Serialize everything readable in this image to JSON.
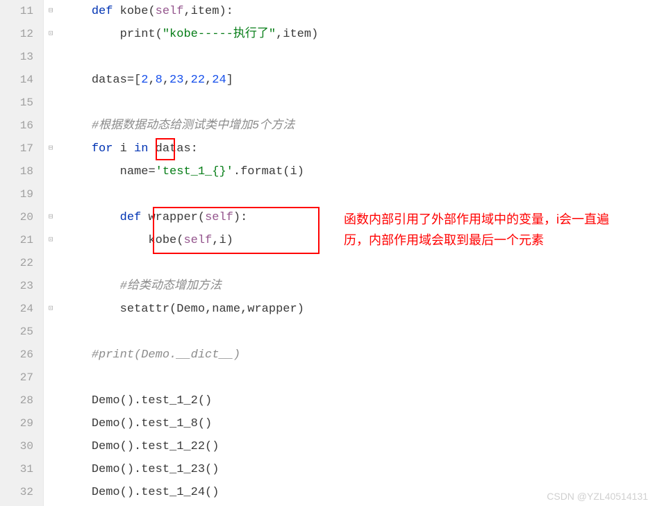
{
  "lines": {
    "11": {
      "n": "11",
      "t": "def",
      "indent": "    "
    },
    "12": {
      "n": "12",
      "indent": "        "
    },
    "13": {
      "n": "13"
    },
    "14": {
      "n": "14",
      "indent": "    "
    },
    "15": {
      "n": "15"
    },
    "16": {
      "n": "16",
      "indent": "    ",
      "comment": "#根据数据动态给测试类中增加5个方法"
    },
    "17": {
      "n": "17",
      "indent": "    "
    },
    "18": {
      "n": "18",
      "indent": "        "
    },
    "19": {
      "n": "19"
    },
    "20": {
      "n": "20",
      "indent": "        "
    },
    "21": {
      "n": "21",
      "indent": "            "
    },
    "22": {
      "n": "22"
    },
    "23": {
      "n": "23",
      "indent": "        ",
      "comment": "#给类动态增加方法"
    },
    "24": {
      "n": "24",
      "indent": "        "
    },
    "25": {
      "n": "25"
    },
    "26": {
      "n": "26",
      "indent": "    ",
      "comment": "#print(Demo.__dict__)"
    },
    "27": {
      "n": "27"
    },
    "28": {
      "n": "28",
      "indent": "    "
    },
    "29": {
      "n": "29",
      "indent": "    "
    },
    "30": {
      "n": "30",
      "indent": "    "
    },
    "31": {
      "n": "31",
      "indent": "    "
    },
    "32": {
      "n": "32",
      "indent": "    "
    }
  },
  "tokens": {
    "def": "def",
    "for": "for",
    "in": "in",
    "kobe": "kobe",
    "wrapper": "wrapper",
    "print": "print",
    "self": "self",
    "item": "item",
    "datas": "datas",
    "i": "i",
    "name": "name",
    "format": "format",
    "setattr": "setattr",
    "Demo": "Demo",
    "str_kobe": "\"kobe-----执行了\"",
    "str_test": "'test_1_{}'",
    "nums": {
      "a": "2",
      "b": "8",
      "c": "23",
      "d": "22",
      "e": "24"
    },
    "calls": {
      "a": "Demo().test_1_2()",
      "b": "Demo().test_1_8()",
      "c": "Demo().test_1_22()",
      "d": "Demo().test_1_23()",
      "e": "Demo().test_1_24()"
    }
  },
  "annotation": {
    "l1": "函数内部引用了外部作用域中的变量，i会一直遍",
    "l2": "历，内部作用域会取到最后一个元素"
  },
  "watermark": "CSDN @YZL40514131"
}
